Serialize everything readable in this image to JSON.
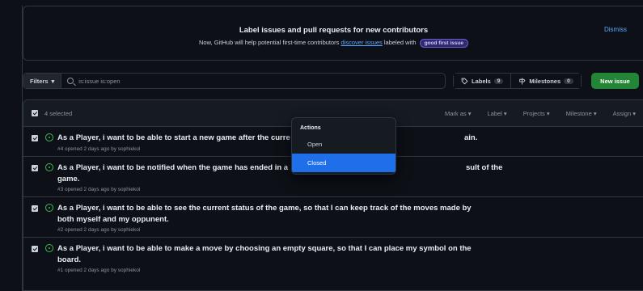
{
  "banner": {
    "title": "Label issues and pull requests for new contributors",
    "sub_prefix": "Now, GitHub will help potential first-time contributors ",
    "sub_link": "discover issues",
    "sub_mid": " labeled with ",
    "label_badge": "good first issue",
    "dismiss": "Dismiss"
  },
  "toolbar": {
    "filters": "Filters",
    "search_value": "is:issue is:open",
    "labels": "Labels",
    "labels_count": "9",
    "milestones": "Milestones",
    "milestones_count": "0",
    "new_issue": "New issue"
  },
  "list_header": {
    "selected": "4 selected",
    "menus": [
      "Mark as",
      "Label",
      "Projects",
      "Milestone",
      "Assign"
    ]
  },
  "dropdown": {
    "heading": "Actions",
    "items": [
      "Open",
      "Closed"
    ],
    "highlighted": "Closed"
  },
  "issues": [
    {
      "title_line1": "As a Player, i want to be able to start a new game after the curre",
      "title_tail": "ain.",
      "meta": "#4 opened 2 days ago by sophiekol"
    },
    {
      "title_line1": "As a Player, i want to be notified when the game has ended in a",
      "title_tail": "sult of the",
      "title_line2": "game.",
      "meta": "#3 opened 2 days ago by sophiekol"
    },
    {
      "title_line1": "As a Player, i want to be able to see the current status of the game, so that I can keep track of the moves made by",
      "title_line2": "both myself and my oppunent.",
      "meta": "#2 opened 2 days ago by sophiekol"
    },
    {
      "title_line1": "As a Player, i want to be able to make a move by choosing an empty square, so that I can place my symbol on the",
      "title_line2": "board.",
      "meta": "#1 opened 2 days ago by sophiekol"
    }
  ]
}
